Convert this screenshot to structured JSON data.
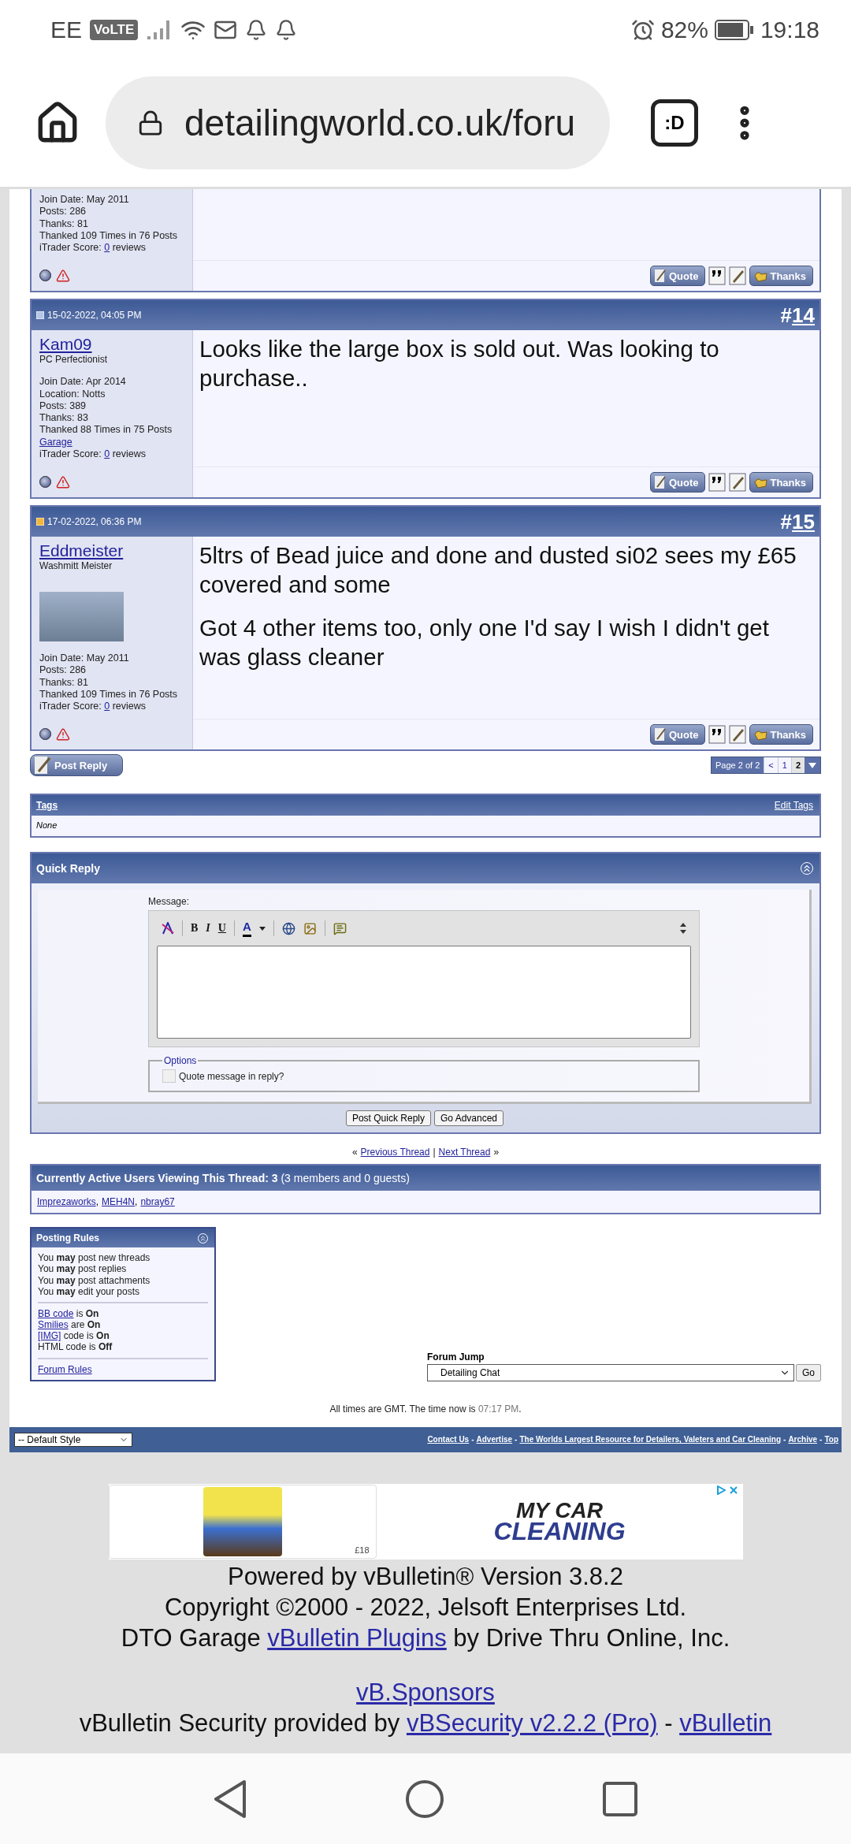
{
  "status_bar": {
    "carrier": "EE",
    "network_badge": "VoLTE",
    "battery": "82%",
    "time": "19:18"
  },
  "browser": {
    "url": "detailingworld.co.uk/foru",
    "tabs_badge": ":D"
  },
  "posts": [
    {
      "kind": "partial",
      "info": [
        {
          "kind": "text",
          "text": "Join Date: May 2011"
        },
        {
          "kind": "text",
          "text": "Posts: 286"
        },
        {
          "kind": "text",
          "text": "Thanks: 81"
        },
        {
          "kind": "text",
          "text": "Thanked 109 Times in 76 Posts"
        },
        {
          "kind": "score",
          "before": "iTrader Score: ",
          "link": "0",
          "after": " reviews"
        }
      ],
      "quote_label": "Quote",
      "thanks_label": "Thanks"
    },
    {
      "kind": "full",
      "date": "15-02-2022, 04:05 PM",
      "unread": false,
      "number_prefix": "#",
      "number": "14",
      "username": "Kam09",
      "user_title": "PC Perfectionist",
      "has_avatar": false,
      "info": [
        {
          "kind": "text",
          "text": "Join Date: Apr 2014"
        },
        {
          "kind": "text",
          "text": "Location: Notts"
        },
        {
          "kind": "text",
          "text": "Posts: 389"
        },
        {
          "kind": "text",
          "text": "Thanks: 83"
        },
        {
          "kind": "text",
          "text": "Thanked 88 Times in 75 Posts"
        },
        {
          "kind": "link",
          "text": "Garage"
        },
        {
          "kind": "score",
          "before": "iTrader Score: ",
          "link": "0",
          "after": " reviews"
        }
      ],
      "body": [
        "Looks like the large box is sold out. Was looking to purchase.."
      ],
      "quote_label": "Quote",
      "thanks_label": "Thanks"
    },
    {
      "kind": "full",
      "date": "17-02-2022, 06:36 PM",
      "unread": true,
      "number_prefix": "#",
      "number": "15",
      "username": "Eddmeister",
      "user_title": "Washmitt Meister",
      "has_avatar": true,
      "info": [
        {
          "kind": "text",
          "text": "Join Date: May 2011"
        },
        {
          "kind": "text",
          "text": "Posts: 286"
        },
        {
          "kind": "text",
          "text": "Thanks: 81"
        },
        {
          "kind": "text",
          "text": "Thanked 109 Times in 76 Posts"
        },
        {
          "kind": "score",
          "before": "iTrader Score: ",
          "link": "0",
          "after": " reviews"
        }
      ],
      "body": [
        "5ltrs of Bead juice and done and dusted si02 sees my £65 covered and some",
        "Got 4 other items too, only one I'd say I wish I didn't get was glass cleaner"
      ],
      "quote_label": "Quote",
      "thanks_label": "Thanks"
    }
  ],
  "post_reply": "Post Reply",
  "pagination": {
    "label": "Page 2 of 2",
    "prev": "<",
    "pages": [
      {
        "label": "1",
        "selected": false
      },
      {
        "label": "2",
        "selected": true
      }
    ]
  },
  "tags": {
    "title": "Tags",
    "edit": "Edit Tags",
    "value": "None"
  },
  "quick_reply": {
    "title": "Quick Reply",
    "message_label": "Message:",
    "format_glyphs": [
      "B",
      "I",
      "U"
    ],
    "color_glyph": "A",
    "options_legend": "Options",
    "quote_label": "Quote message in reply?",
    "quote_checked": false,
    "buttons": [
      "Post Quick Reply",
      "Go Advanced"
    ]
  },
  "thread_nav": {
    "open": "«",
    "previous": "Previous Thread",
    "divider": "|",
    "next": "Next Thread",
    "close": "»"
  },
  "active_users": {
    "title": "**Currently Active Users Viewing This Thread: 3** (3 members and 0 guests)",
    "users": [
      "Imprezaworks",
      "MEH4N",
      "nbray67"
    ],
    "separator": ","
  },
  "posting_rules": {
    "title": "Posting Rules",
    "permissions": [
      "You **may** post new threads",
      "You **may** post replies",
      "You **may** post attachments",
      "You **may** edit your posts"
    ],
    "settings": [
      {
        "link": "BB code",
        "rest": " is **On**"
      },
      {
        "link": "Smilies",
        "rest": " are **On**"
      },
      {
        "link": "[IMG]",
        "rest": " code is **On**"
      },
      {
        "rest": "HTML code is **Off**"
      }
    ],
    "rules_link": "Forum Rules"
  },
  "forum_jump": {
    "label": "Forum Jump",
    "value": "Detailing Chat",
    "go": "Go"
  },
  "time_line": {
    "before": "All times are GMT. The time now is ",
    "time": "07:17 PM",
    "after": "."
  },
  "footer": {
    "style": "-- Default Style",
    "links": [
      "Contact Us",
      "Advertise",
      "The Worlds Largest Resource for Detailers, Valeters and Car Cleaning",
      "Archive",
      "Top"
    ],
    "separator": "-"
  },
  "ad": {
    "price": "£18",
    "logo_top": "MY CAR",
    "logo_bottom": "CLEANING"
  },
  "powered": {
    "line1": "Powered by vBulletin® Version 3.8.2",
    "line2": "Copyright ©2000 - 2022, Jelsoft Enterprises Ltd.",
    "dto_before": "DTO Garage ",
    "dto_link": "vBulletin Plugins",
    "dto_after": " by Drive Thru Online, Inc.",
    "sponsors": "vB.Sponsors",
    "security_before": "vBulletin Security provided by ",
    "security_link": "vBSecurity v2.2.2 (Pro)",
    "security_sep": " - ",
    "security_link2": "vBulletin"
  }
}
